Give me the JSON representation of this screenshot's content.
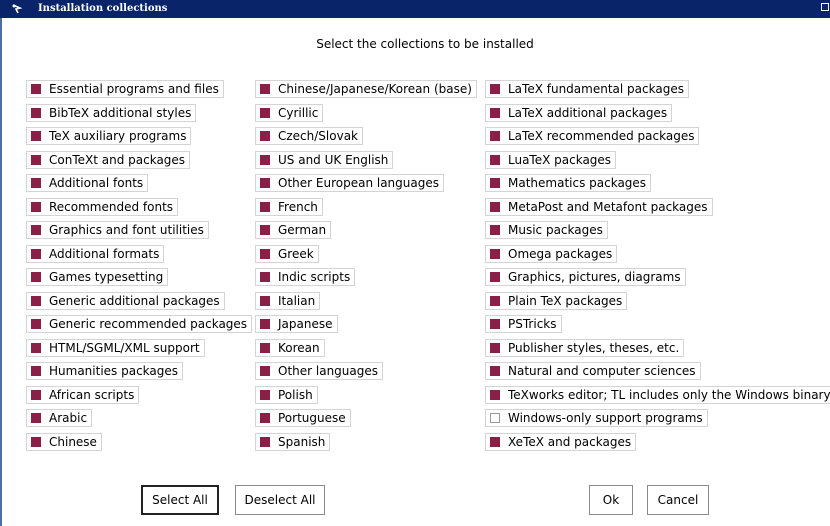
{
  "window": {
    "title": "Installation collections"
  },
  "heading": "Select the collections to be installed",
  "columns": [
    [
      {
        "label": "Essential programs and files",
        "checked": true
      },
      {
        "label": "BibTeX additional styles",
        "checked": true
      },
      {
        "label": "TeX auxiliary programs",
        "checked": true
      },
      {
        "label": "ConTeXt and packages",
        "checked": true
      },
      {
        "label": "Additional fonts",
        "checked": true
      },
      {
        "label": "Recommended fonts",
        "checked": true
      },
      {
        "label": "Graphics and font utilities",
        "checked": true
      },
      {
        "label": "Additional formats",
        "checked": true
      },
      {
        "label": "Games typesetting",
        "checked": true
      },
      {
        "label": "Generic additional packages",
        "checked": true
      },
      {
        "label": "Generic recommended packages",
        "checked": true
      },
      {
        "label": "HTML/SGML/XML support",
        "checked": true
      },
      {
        "label": "Humanities packages",
        "checked": true
      },
      {
        "label": "African scripts",
        "checked": true
      },
      {
        "label": "Arabic",
        "checked": true
      },
      {
        "label": "Chinese",
        "checked": true
      }
    ],
    [
      {
        "label": "Chinese/Japanese/Korean (base)",
        "checked": true
      },
      {
        "label": "Cyrillic",
        "checked": true
      },
      {
        "label": "Czech/Slovak",
        "checked": true
      },
      {
        "label": "US and UK English",
        "checked": true
      },
      {
        "label": "Other European languages",
        "checked": true
      },
      {
        "label": "French",
        "checked": true
      },
      {
        "label": "German",
        "checked": true
      },
      {
        "label": "Greek",
        "checked": true
      },
      {
        "label": "Indic scripts",
        "checked": true
      },
      {
        "label": "Italian",
        "checked": true
      },
      {
        "label": "Japanese",
        "checked": true
      },
      {
        "label": "Korean",
        "checked": true
      },
      {
        "label": "Other languages",
        "checked": true
      },
      {
        "label": "Polish",
        "checked": true
      },
      {
        "label": "Portuguese",
        "checked": true
      },
      {
        "label": "Spanish",
        "checked": true
      }
    ],
    [
      {
        "label": "LaTeX fundamental packages",
        "checked": true
      },
      {
        "label": "LaTeX additional packages",
        "checked": true
      },
      {
        "label": "LaTeX recommended packages",
        "checked": true
      },
      {
        "label": "LuaTeX packages",
        "checked": true
      },
      {
        "label": "Mathematics packages",
        "checked": true
      },
      {
        "label": "MetaPost and Metafont packages",
        "checked": true
      },
      {
        "label": "Music packages",
        "checked": true
      },
      {
        "label": "Omega packages",
        "checked": true
      },
      {
        "label": "Graphics, pictures, diagrams",
        "checked": true
      },
      {
        "label": "Plain TeX packages",
        "checked": true
      },
      {
        "label": "PSTricks",
        "checked": true
      },
      {
        "label": "Publisher styles, theses, etc.",
        "checked": true
      },
      {
        "label": "Natural and computer sciences",
        "checked": true
      },
      {
        "label": "TeXworks editor; TL includes only the Windows binary",
        "checked": true
      },
      {
        "label": "Windows-only support programs",
        "checked": false
      },
      {
        "label": "XeTeX and packages",
        "checked": true
      }
    ]
  ],
  "buttons": {
    "select_all": "Select All",
    "deselect_all": "Deselect All",
    "ok": "Ok",
    "cancel": "Cancel"
  },
  "colors": {
    "checked": "#8a1f47",
    "titlebar": "#0a246a"
  }
}
